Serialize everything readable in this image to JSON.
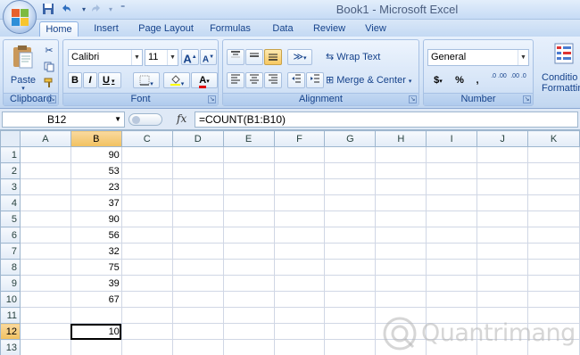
{
  "window": {
    "title": "Book1 - Microsoft Excel"
  },
  "quick_access": {
    "save_icon": "save-icon",
    "undo_icon": "undo-icon",
    "redo_icon": "redo-icon",
    "customize_icon": "customize-icon"
  },
  "tabs": [
    {
      "label": "Home",
      "active": true
    },
    {
      "label": "Insert"
    },
    {
      "label": "Page Layout"
    },
    {
      "label": "Formulas"
    },
    {
      "label": "Data"
    },
    {
      "label": "Review"
    },
    {
      "label": "View"
    }
  ],
  "ribbon": {
    "clipboard": {
      "label": "Clipboard",
      "paste": "Paste"
    },
    "font": {
      "label": "Font",
      "font_name": "Calibri",
      "font_size": "11",
      "bold": "B",
      "italic": "I",
      "underline": "U",
      "grow": "A",
      "shrink": "A",
      "font_color": "A"
    },
    "alignment": {
      "label": "Alignment",
      "wrap_text": "Wrap Text",
      "merge_center": "Merge & Center"
    },
    "number": {
      "label": "Number",
      "format": "General",
      "currency": "$",
      "percent": "%",
      "comma": ",",
      "inc_decimal": ".0 .00",
      "dec_decimal": ".00 .0"
    },
    "styles": {
      "conditional_formatting_line1": "Conditio",
      "conditional_formatting_line2": "Formattin"
    }
  },
  "formula_bar": {
    "name_box": "B12",
    "fx": "fx",
    "formula": "=COUNT(B1:B10)"
  },
  "grid": {
    "columns": [
      "A",
      "B",
      "C",
      "D",
      "E",
      "F",
      "G",
      "H",
      "I",
      "J",
      "K"
    ],
    "rows": [
      "1",
      "2",
      "3",
      "4",
      "5",
      "6",
      "7",
      "8",
      "9",
      "10",
      "11",
      "12",
      "13"
    ],
    "column_b_values": [
      "90",
      "53",
      "23",
      "37",
      "90",
      "56",
      "32",
      "75",
      "39",
      "67",
      "",
      "10",
      ""
    ],
    "active_cell": "B12"
  },
  "watermark": {
    "text": "Quantrimang"
  },
  "colors": {
    "ribbon_bg": "#d6e5f7",
    "selected_header": "#f1c15f",
    "grid_line": "#d0d7e5",
    "text_blue": "#15428b"
  }
}
